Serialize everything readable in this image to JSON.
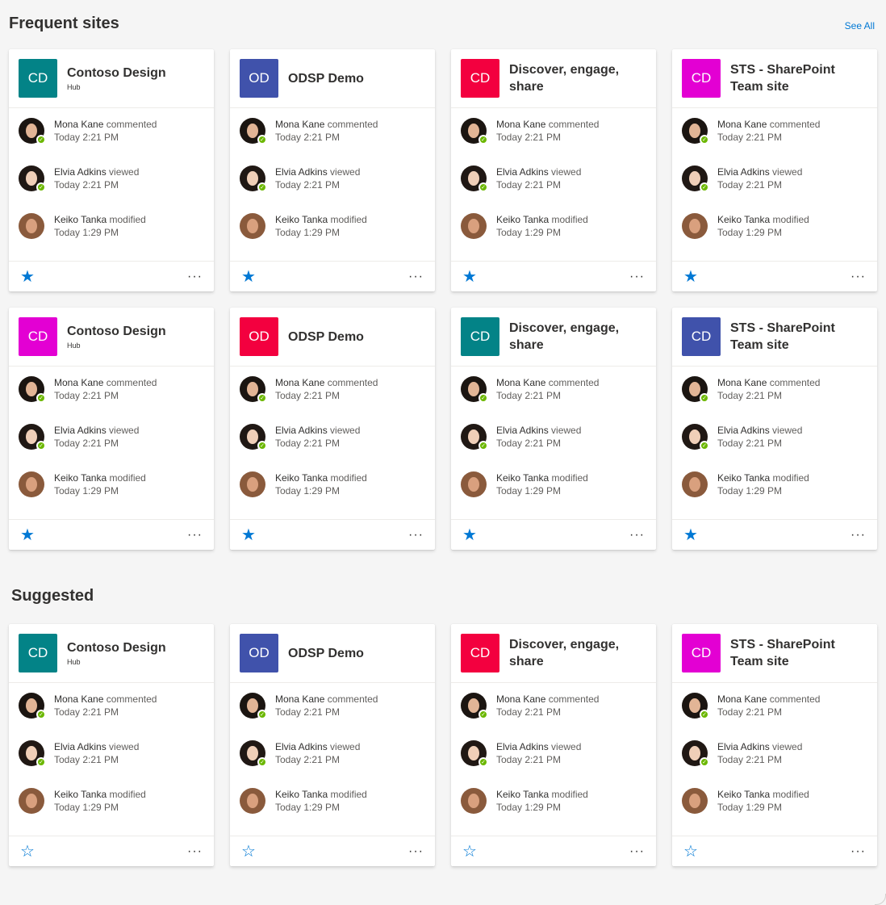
{
  "sections": [
    {
      "title": "Frequent sites",
      "see_all": "See All"
    },
    {
      "title": "Suggested"
    }
  ],
  "people": [
    {
      "name": "Mona Kane",
      "action": "commented",
      "time": "Today 2:21 PM",
      "hair": "#1b1511",
      "skin": "#e2b596"
    },
    {
      "name": "Elvia Adkins",
      "action": "viewed",
      "time": "Today 2:21 PM",
      "hair": "#201814",
      "skin": "#f0cfb8"
    },
    {
      "name": "Keiko Tanka",
      "action": "modified",
      "time": "Today 1:29 PM",
      "hair": "#8a5a3c",
      "skin": "#d9a07e"
    }
  ],
  "cards": [
    {
      "initials": "CD",
      "name": "Contoso Design",
      "sub": "Hub",
      "color": "#038387",
      "favorite": true
    },
    {
      "initials": "OD",
      "name": "ODSP Demo",
      "sub": "",
      "color": "#4052ab",
      "favorite": true
    },
    {
      "initials": "CD",
      "name": "Discover, engage, share",
      "sub": "",
      "color": "#f3003f",
      "favorite": true
    },
    {
      "initials": "CD",
      "name": "STS - SharePoint Team site",
      "sub": "",
      "color": "#e300d3",
      "favorite": true
    },
    {
      "initials": "CD",
      "name": "Contoso Design",
      "sub": "Hub",
      "color": "#e300d3",
      "favorite": true
    },
    {
      "initials": "OD",
      "name": "ODSP Demo",
      "sub": "",
      "color": "#f3003f",
      "favorite": true
    },
    {
      "initials": "CD",
      "name": "Discover, engage, share",
      "sub": "",
      "color": "#038387",
      "favorite": true
    },
    {
      "initials": "CD",
      "name": "STS - SharePoint Team site",
      "sub": "",
      "color": "#4052ab",
      "favorite": true
    },
    {
      "initials": "CD",
      "name": "Contoso Design",
      "sub": "Hub",
      "color": "#038387",
      "favorite": false
    },
    {
      "initials": "OD",
      "name": "ODSP Demo",
      "sub": "",
      "color": "#4052ab",
      "favorite": false
    },
    {
      "initials": "CD",
      "name": "Discover, engage, share",
      "sub": "",
      "color": "#f3003f",
      "favorite": false
    },
    {
      "initials": "CD",
      "name": "STS - SharePoint Team site",
      "sub": "",
      "color": "#e300d3",
      "favorite": false
    }
  ],
  "icons": {
    "favorite_on": "★",
    "favorite_off": "☆",
    "more": "···",
    "presence": "✓"
  }
}
